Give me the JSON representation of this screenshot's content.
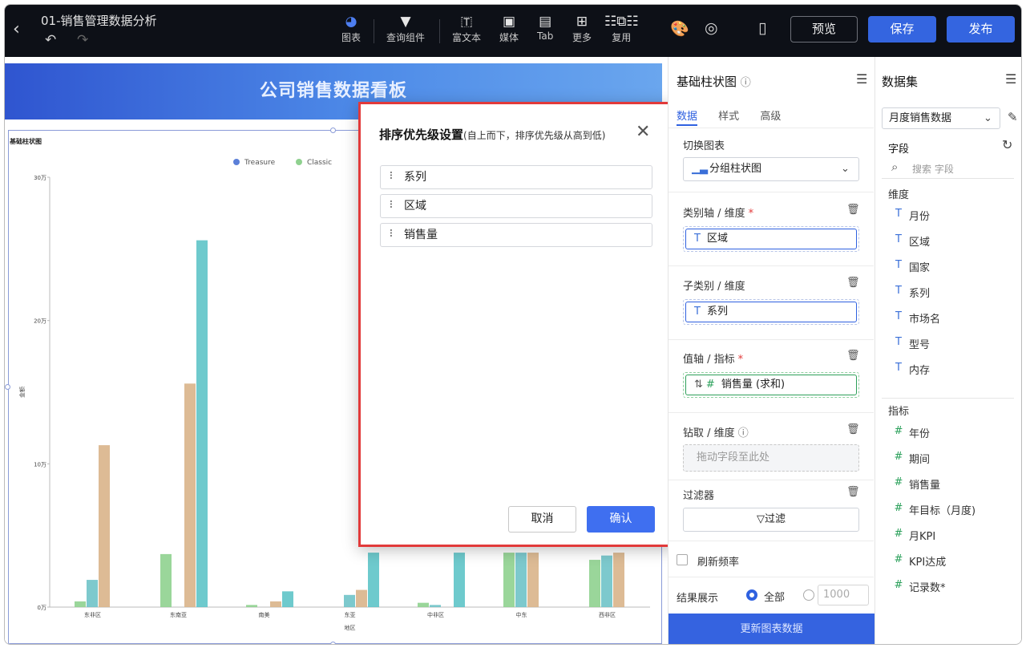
{
  "topbar": {
    "title": "01-销售管理数据分析",
    "tools": [
      {
        "label": "图表",
        "icon": "pie-chart-icon"
      },
      {
        "label": "查询组件",
        "icon": "funnel-icon"
      },
      {
        "label": "富文本",
        "icon": "text-box-icon"
      },
      {
        "label": "媒体",
        "icon": "image-icon"
      },
      {
        "label": "Tab",
        "icon": "tab-icon"
      },
      {
        "label": "更多",
        "icon": "grid-icon"
      },
      {
        "label": "复用",
        "icon": "reuse-icon"
      }
    ],
    "preview": "预览",
    "save": "保存",
    "publish": "发布"
  },
  "canvas": {
    "banner_title": "公司销售数据看板",
    "chart_title": "基础柱状图",
    "legend": [
      "Treasure",
      "Classic"
    ]
  },
  "chart_data": {
    "type": "bar",
    "title": "基础柱状图",
    "xlabel": "地区",
    "ylabel": "金额",
    "categories": [
      "东非区",
      "东南亚",
      "南美",
      "东亚",
      "中非区",
      "中东",
      "西非区"
    ],
    "y_ticks": [
      "0万",
      "10万",
      "20万",
      "30万"
    ],
    "ylim": [
      0,
      300000
    ],
    "series": [
      {
        "name": "Treasure",
        "color": "#5b7fd8",
        "values": [
          0,
          0,
          0,
          0,
          0,
          0,
          0
        ]
      },
      {
        "name": "Classic",
        "color": "#8fd18f",
        "values": [
          4000,
          37000,
          1500,
          0,
          3000,
          38000,
          33000
        ]
      },
      {
        "name": "",
        "color": "#6fc3c8",
        "values": [
          19000,
          0,
          0,
          8500,
          1500,
          38000,
          36000
        ]
      },
      {
        "name": "",
        "color": "#d9b48a",
        "values": [
          113000,
          156000,
          4000,
          12000,
          0,
          38000,
          38000
        ]
      },
      {
        "name": "",
        "color": "#5ec4c8",
        "values": [
          0,
          256000,
          11000,
          38000,
          38000,
          0,
          0
        ]
      }
    ]
  },
  "modal": {
    "title": "排序优先级设置",
    "subtitle": "(自上而下，排序优先级从高到低)",
    "items": [
      "系列",
      "区域",
      "销售量"
    ],
    "cancel": "取消",
    "confirm": "确认"
  },
  "config": {
    "title": "基础柱状图",
    "tabs": [
      "数据",
      "样式",
      "高级"
    ],
    "switch_chart_label": "切换图表",
    "switch_chart_value": "分组柱状图",
    "category_axis_label": "类别轴 / 维度",
    "category_axis_field": "区域",
    "sub_category_label": "子类别 / 维度",
    "sub_category_field": "系列",
    "value_axis_label": "值轴 / 指标",
    "value_axis_field": "销售量 (求和)",
    "drill_label": "钻取 / 维度",
    "drill_placeholder": "拖动字段至此处",
    "filter_label": "过滤器",
    "filter_button": "过滤",
    "refresh_label": "刷新频率",
    "result_label": "结果展示",
    "result_all": "全部",
    "result_limit_placeholder": "1000",
    "update_button": "更新图表数据"
  },
  "dataset": {
    "title": "数据集",
    "selected": "月度销售数据",
    "fields_label": "字段",
    "search_placeholder": "搜索 字段",
    "dimension_label": "维度",
    "dimensions": [
      "月份",
      "区域",
      "国家",
      "系列",
      "市场名",
      "型号",
      "内存"
    ],
    "metric_label": "指标",
    "metrics": [
      "年份",
      "期间",
      "销售量",
      "年目标（月度)",
      "月KPI",
      "KPI达成",
      "记录数*"
    ]
  }
}
